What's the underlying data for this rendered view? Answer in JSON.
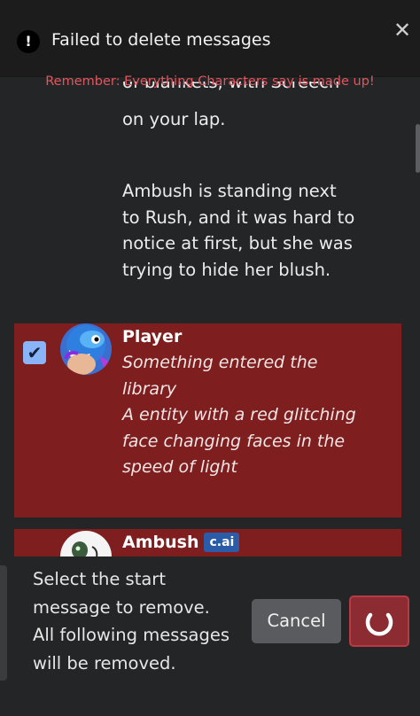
{
  "toast": {
    "icon": "exclamation-icon",
    "icon_glyph": "!",
    "message": "Failed to delete messages",
    "close_glyph": "✕"
  },
  "disclaimer": "Remember: Everything Characters say is made up!",
  "chat": {
    "partial_top_text": "of blankets, with Screech",
    "prev_message_lines": [
      "on your lap.",
      "",
      "Ambush is standing next",
      "to Rush, and it was hard to",
      "notice at first, but she was",
      "trying to hide her blush."
    ],
    "player_message": {
      "name": "Player",
      "checked": true,
      "check_glyph": "✔",
      "lines": [
        "Something entered the",
        "library",
        "A entity with a red glitching",
        "face changing faces in the",
        "speed of light"
      ]
    },
    "ambush_message": {
      "name": "Ambush",
      "badge": "c.ai"
    }
  },
  "bottom": {
    "instruction_lines": [
      "Select the start",
      "message to remove.",
      "All following messages",
      "will be removed."
    ],
    "cancel_label": "Cancel",
    "confirm_icon": "spinner-icon"
  },
  "colors": {
    "selected_row": "#7e1e1e",
    "disclaimer": "#e2555d",
    "confirm_button": "#8c2b32",
    "cai_badge": "#2b5ca8"
  }
}
